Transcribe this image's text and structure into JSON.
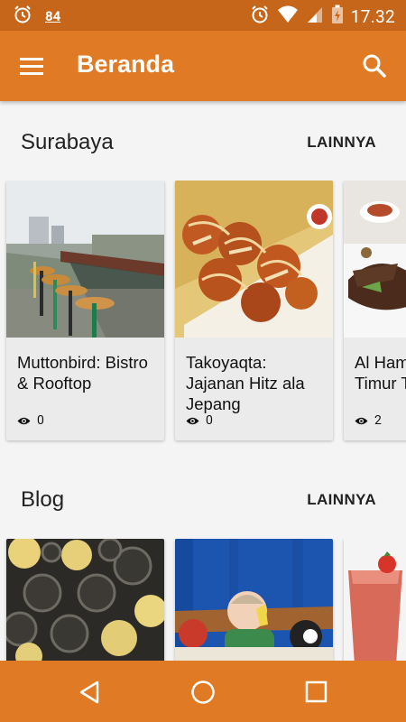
{
  "status_bar": {
    "notification_count": "84",
    "time": "17.32"
  },
  "app_bar": {
    "title": "Beranda"
  },
  "sections": [
    {
      "title": "Surabaya",
      "more_label": "LAINNYA",
      "cards": [
        {
          "title": "Muttonbird: Bistro & Rooftop",
          "views": "0"
        },
        {
          "title": "Takoyaqta: Jajanan Hitz ala Jepang",
          "views": "0"
        },
        {
          "title": "Al Ham Restor Timur T",
          "views": "2"
        }
      ]
    },
    {
      "title": "Blog",
      "more_label": "LAINNYA"
    }
  ],
  "colors": {
    "accent": "#e07a24",
    "status_bar": "#c6661a",
    "card_bg": "#ebebeb"
  }
}
